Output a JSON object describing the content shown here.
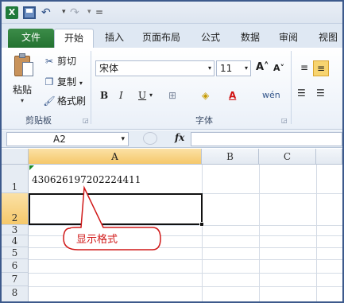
{
  "qat": {
    "app_icon": "X",
    "separator": "|",
    "customize": "="
  },
  "tabs": [
    {
      "label": "文件"
    },
    {
      "label": "开始"
    },
    {
      "label": "插入"
    },
    {
      "label": "页面布局"
    },
    {
      "label": "公式"
    },
    {
      "label": "数据"
    },
    {
      "label": "审阅"
    },
    {
      "label": "视图"
    }
  ],
  "clipboard": {
    "paste_label": "粘贴",
    "cut_label": "剪切",
    "copy_label": "复制",
    "copy_arrow": "▾",
    "format_painter_label": "格式刷",
    "group_label": "剪贴板",
    "cut_icon": "scissors-icon",
    "copy_icon": "copy-icon",
    "painter_icon": "format-painter-icon"
  },
  "font": {
    "family": "宋体",
    "size": "11",
    "grow": "A˄",
    "shrink": "A˅",
    "bold": "B",
    "italic": "I",
    "underline": "U",
    "border": "⊞",
    "fill": "◈",
    "font_color": "A",
    "phonetic": "wén",
    "group_label": "字体"
  },
  "formula_bar": {
    "name_box": "A2",
    "fx": "fx",
    "value": ""
  },
  "sheet": {
    "columns": [
      "A",
      "B",
      "C"
    ],
    "rows": [
      "1",
      "2",
      "3",
      "4",
      "5",
      "6",
      "7",
      "8"
    ],
    "cell_a1": "430626197202224411",
    "active_cell": "A2"
  },
  "annotation": {
    "label": "显示格式",
    "color": "#d01818"
  }
}
